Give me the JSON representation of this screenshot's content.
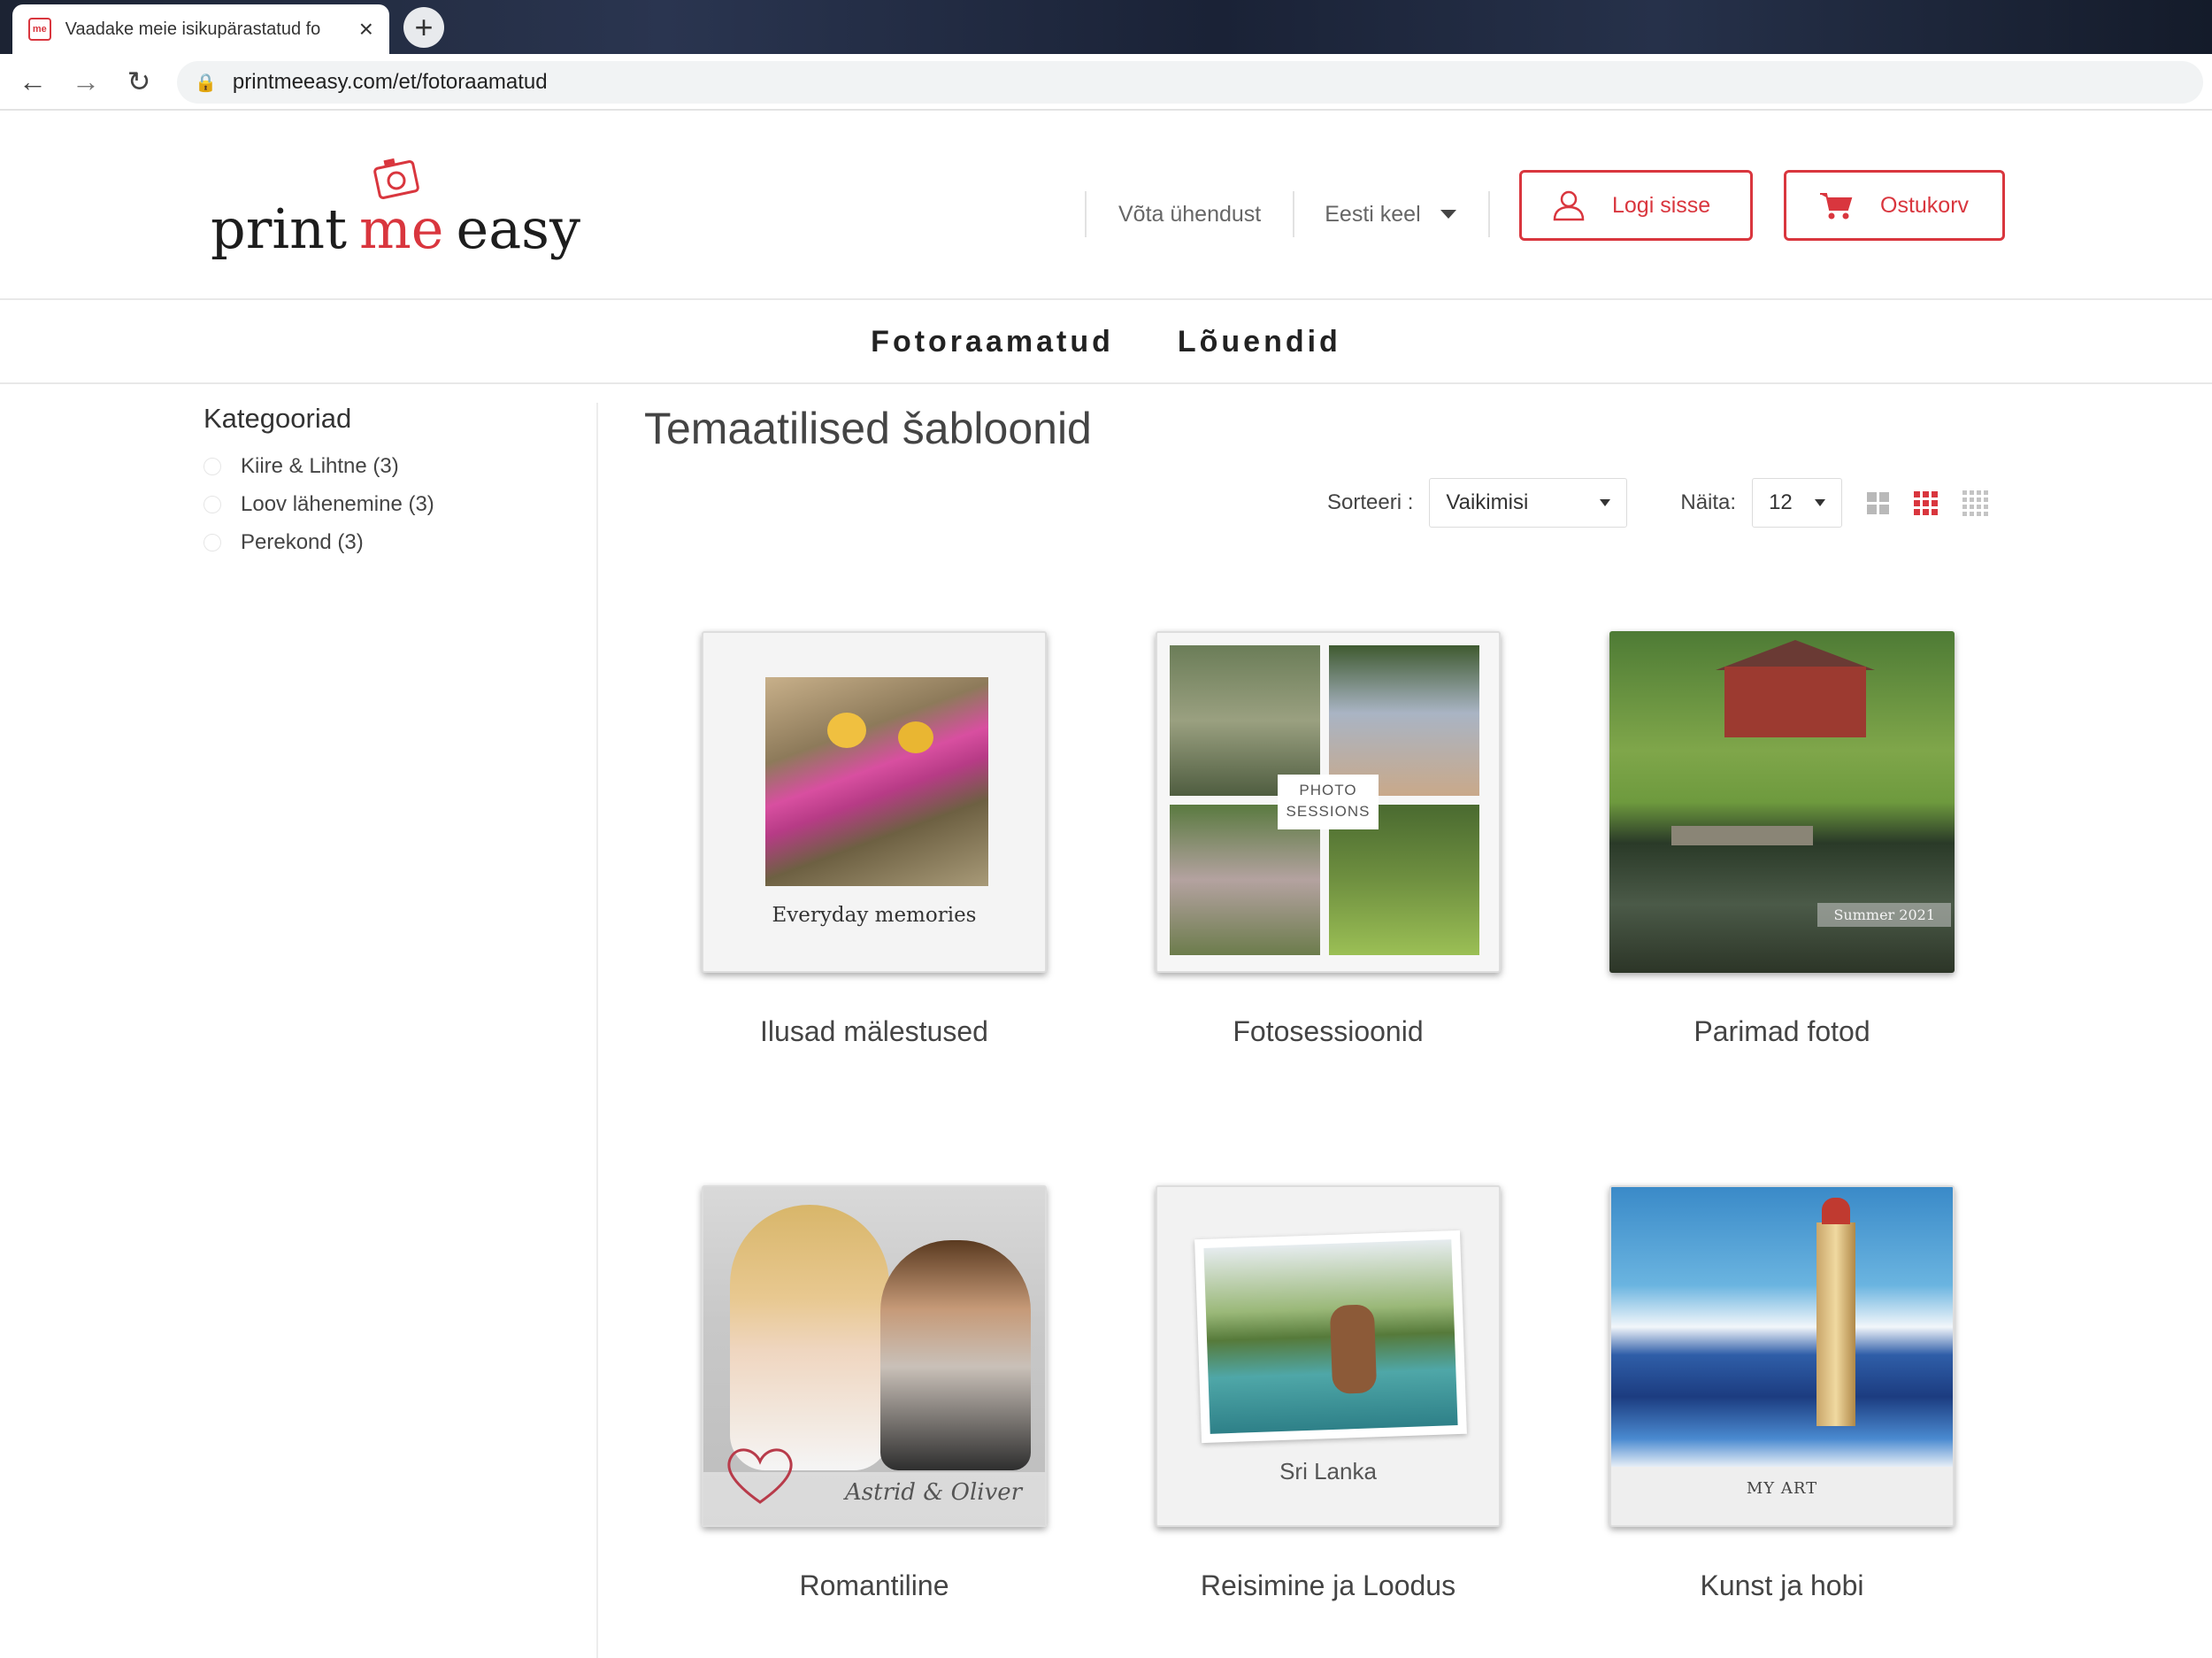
{
  "browser": {
    "tab_title": "Vaadake meie isikupärastatud fo",
    "favicon_text": "me",
    "url": "printmeeasy.com/et/fotoraamatud"
  },
  "header": {
    "logo": {
      "part1": "print",
      "part2": "me",
      "part3": "easy"
    },
    "contact_link": "Võta ühendust",
    "language": "Eesti keel",
    "login_label": "Logi sisse",
    "cart_label": "Ostukorv",
    "brand_color": "#d9363e"
  },
  "main_nav": {
    "items": [
      "Fotoraamatud",
      "Lõuendid"
    ]
  },
  "sidebar": {
    "title": "Kategooriad",
    "categories": [
      {
        "label": "Kiire & Lihtne (3)"
      },
      {
        "label": "Loov lähenemine (3)"
      },
      {
        "label": "Perekond (3)"
      }
    ]
  },
  "content": {
    "page_title": "Temaatilised šabloonid",
    "sort_label": "Sorteeri :",
    "sort_value": "Vaikimisi",
    "show_label": "Näita:",
    "show_value": "12",
    "active_view_color": "#d9363e",
    "products": [
      {
        "title": "Ilusad mälestused",
        "cover_text": "Everyday memories"
      },
      {
        "title": "Fotosessioonid",
        "cover_text_line1": "PHOTO",
        "cover_text_line2": "SESSIONS"
      },
      {
        "title": "Parimad fotod",
        "cover_text": "Summer 2021"
      },
      {
        "title": "Romantiline",
        "cover_text": "Astrid & Oliver"
      },
      {
        "title": "Reisimine ja Loodus",
        "cover_text": "Sri Lanka"
      },
      {
        "title": "Kunst ja hobi",
        "cover_text": "MY ART"
      }
    ]
  }
}
